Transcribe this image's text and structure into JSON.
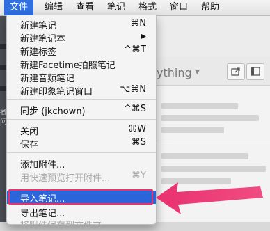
{
  "menubar": {
    "items": [
      {
        "label": "文件",
        "active": true
      },
      {
        "label": "编辑"
      },
      {
        "label": "查看"
      },
      {
        "label": "笔记"
      },
      {
        "label": "格式"
      },
      {
        "label": "窗口"
      },
      {
        "label": "帮助"
      }
    ]
  },
  "file_menu": {
    "items": [
      {
        "label": "新建笔记",
        "shortcut": "⌘N"
      },
      {
        "label": "新建笔记本",
        "shortcut": "▶"
      },
      {
        "label": "新建标签",
        "shortcut": "^⌘T"
      },
      {
        "label": "新建Facetime拍照笔记",
        "shortcut": ""
      },
      {
        "label": "新建音频笔记",
        "shortcut": ""
      },
      {
        "label": "新建印象笔记窗口",
        "shortcut": "⌥⌘N"
      },
      {
        "label": "同步 (jkchown)",
        "shortcut": "^⌘S"
      },
      {
        "label": "关闭",
        "shortcut": "⌘W"
      },
      {
        "label": "保存",
        "shortcut": "⌘S"
      },
      {
        "label": "添加附件...",
        "shortcut": ""
      },
      {
        "label": "用快速预览打开附件...",
        "shortcut": "⌘Y",
        "disabled": true
      },
      {
        "label": "导入笔记...",
        "shortcut": "",
        "highlighted": true
      },
      {
        "label": "导出笔记...",
        "shortcut": ""
      },
      {
        "label": "将附件保存到文件夹...",
        "shortcut": "",
        "disabled": true
      }
    ]
  },
  "background": {
    "search_text": "ything",
    "sidebar_fragments": [
      "者",
      "问"
    ]
  },
  "colors": {
    "menu_highlight": "#2a66d9",
    "annotation": "#e9316f"
  }
}
